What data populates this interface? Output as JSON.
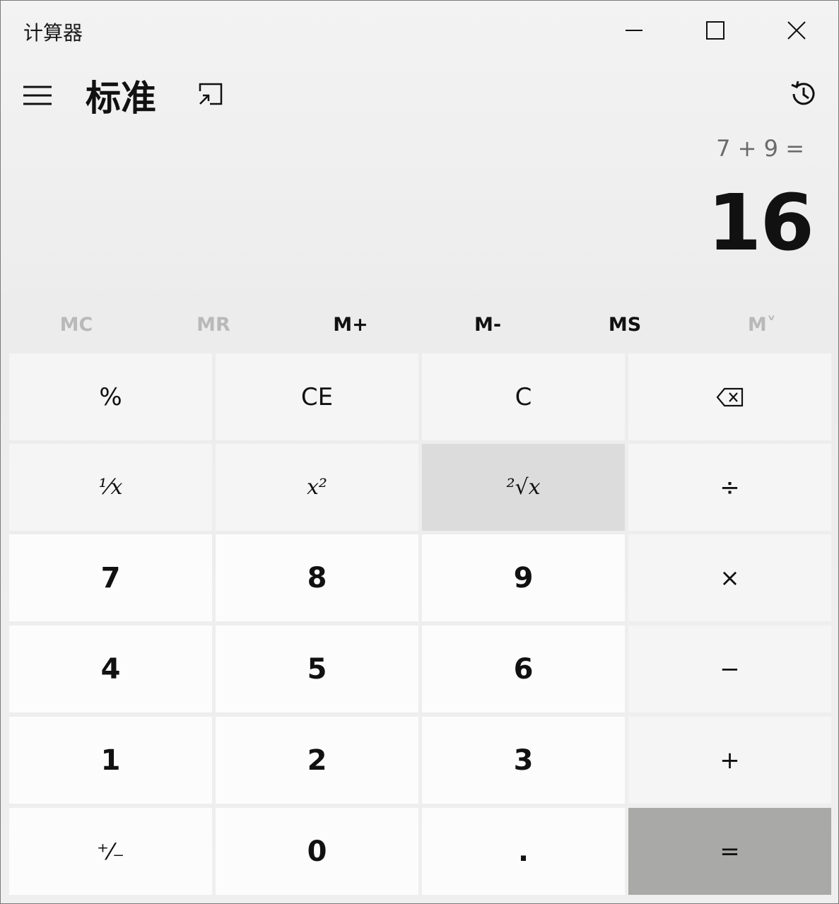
{
  "window": {
    "title": "计算器"
  },
  "header": {
    "mode": "标准"
  },
  "display": {
    "expression": "7 + 9 =",
    "result": "16"
  },
  "memory": [
    {
      "label": "MC",
      "enabled": false
    },
    {
      "label": "MR",
      "enabled": false
    },
    {
      "label": "M+",
      "enabled": true
    },
    {
      "label": "M-",
      "enabled": true
    },
    {
      "label": "MS",
      "enabled": true
    },
    {
      "label": "M˅",
      "enabled": false
    }
  ],
  "keys": {
    "percent": "%",
    "ce": "CE",
    "c": "C",
    "reciprocal": "¹⁄x",
    "square": "x²",
    "sqrt": "²√x",
    "divide": "÷",
    "multiply": "×",
    "minus": "−",
    "plus": "+",
    "equals": "=",
    "negate": "⁺⁄₋",
    "decimal": ".",
    "d0": "0",
    "d1": "1",
    "d2": "2",
    "d3": "3",
    "d4": "4",
    "d5": "5",
    "d6": "6",
    "d7": "7",
    "d8": "8",
    "d9": "9"
  },
  "icons": {
    "minimize": "minimize-icon",
    "maximize": "maximize-icon",
    "close": "close-icon",
    "navigation": "hamburger-menu-icon",
    "keep_on_top": "keep-on-top-icon",
    "history": "history-icon",
    "backspace": "backspace-icon"
  }
}
